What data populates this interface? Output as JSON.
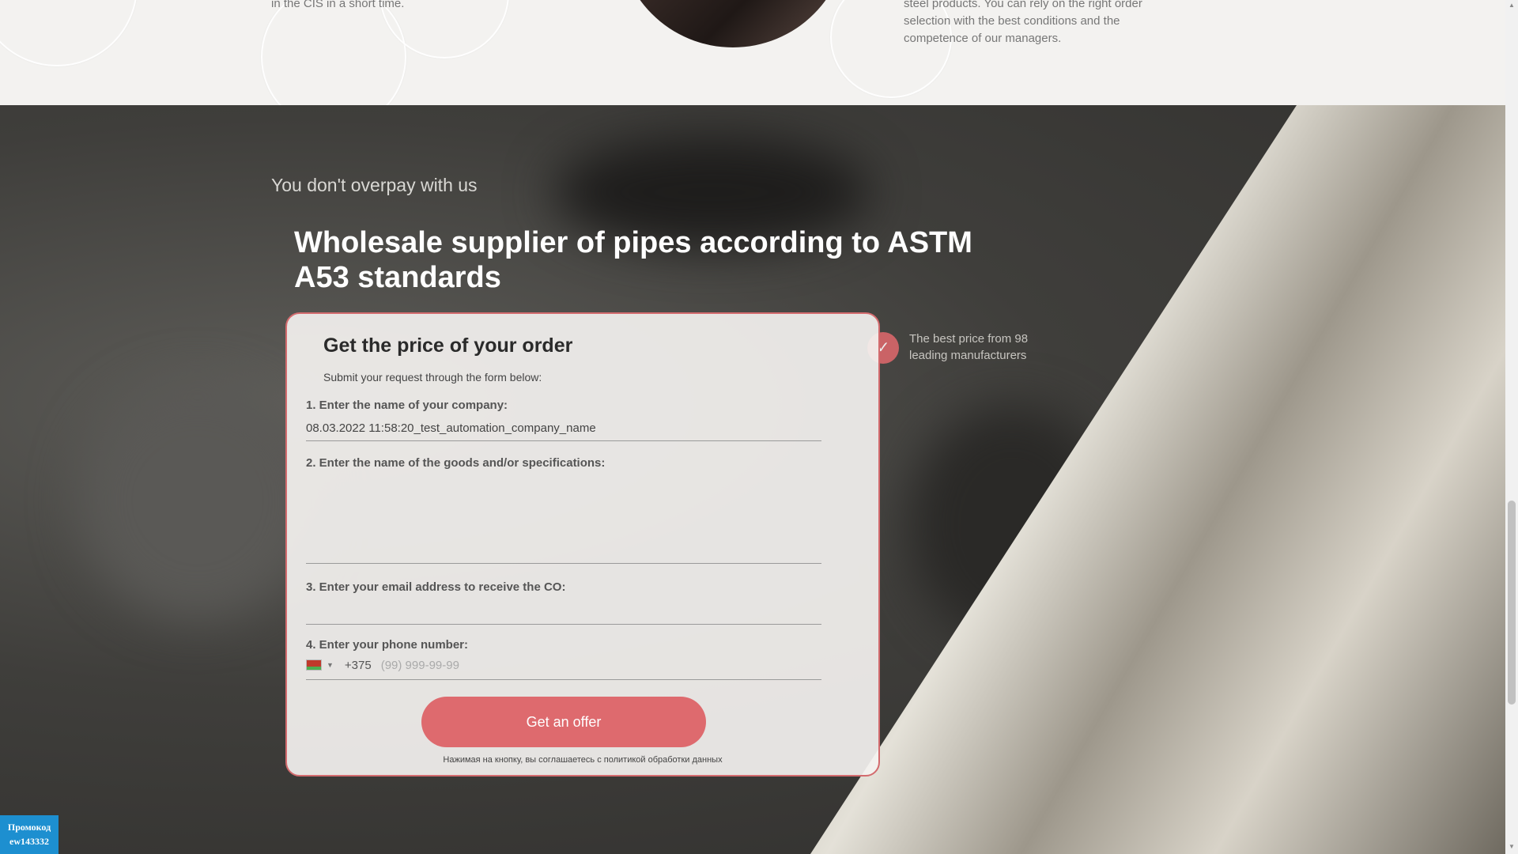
{
  "top": {
    "left_text": "in the CIS in a short time.",
    "right_text": "steel products. You can rely on the right order selection with the best conditions and the competence of our managers."
  },
  "section": {
    "subtitle": "You don't overpay with us",
    "title": "Wholesale supplier of pipes according to ASTM A53 standards",
    "benefit": "The best price from 98 leading manufacturers"
  },
  "form": {
    "title": "Get the price of your order",
    "subtitle": "Submit your request through the form below:",
    "company_label": "1. Enter the name of your company:",
    "company_value": "08.03.2022 11:58:20_test_automation_company_name",
    "goods_label": "2. Enter the name of the goods and/or specifications:",
    "email_label": "3. Enter your email address to receive the CO:",
    "phone_label": "4. Enter your phone number:",
    "phone_code": "+375",
    "phone_placeholder": "(99) 999-99-99",
    "submit_label": "Get an offer",
    "consent": "Нажимая на кнопку, вы соглашаетесь с политикой обработки данных"
  },
  "promo": {
    "line1": "Промокод",
    "line2": "ew143332"
  },
  "colors": {
    "accent": "#de6a6e",
    "promo": "#1d8fd0"
  },
  "icons": [
    "check-icon",
    "belarus-flag-icon",
    "dropdown-caret-icon"
  ]
}
